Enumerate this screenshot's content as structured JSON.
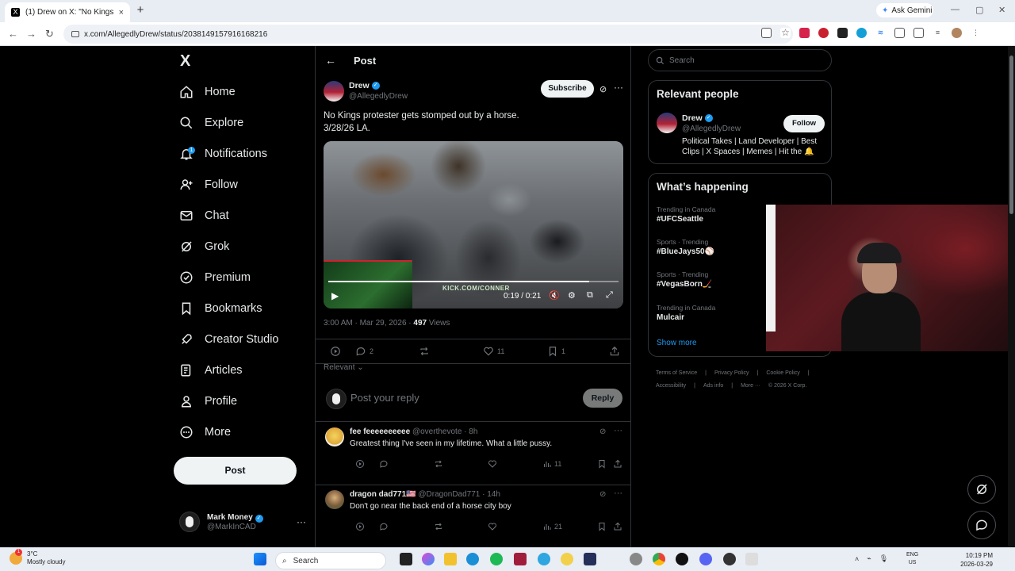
{
  "browser": {
    "tab_title": "(1) Drew on X: \"No Kings prote",
    "tab_favicon": "X",
    "tab_close": "×",
    "new_tab": "+",
    "ask_gemini": "Ask Gemini",
    "url": "x.com/AllegedlyDrew/status/2038149157916168216"
  },
  "sidebar": {
    "logo": "X",
    "items": [
      {
        "label": "Home",
        "icon": "home-icon"
      },
      {
        "label": "Explore",
        "icon": "search-icon"
      },
      {
        "label": "Notifications",
        "icon": "bell-icon",
        "badge": "1"
      },
      {
        "label": "Follow",
        "icon": "add-person-icon"
      },
      {
        "label": "Chat",
        "icon": "mail-icon"
      },
      {
        "label": "Grok",
        "icon": "grok-icon"
      },
      {
        "label": "Premium",
        "icon": "verified-icon"
      },
      {
        "label": "Bookmarks",
        "icon": "bookmark-icon"
      },
      {
        "label": "Creator Studio",
        "icon": "rocket-icon"
      },
      {
        "label": "Articles",
        "icon": "articles-icon"
      },
      {
        "label": "Profile",
        "icon": "person-icon"
      },
      {
        "label": "More",
        "icon": "more-circle-icon"
      }
    ],
    "post_button": "Post",
    "account": {
      "name": "Mark Money",
      "handle": "@MarkInCAD",
      "more": "···"
    }
  },
  "post": {
    "header_title": "Post",
    "author_name": "Drew",
    "author_handle": "@AllegedlyDrew",
    "subscribe": "Subscribe",
    "more": "···",
    "text_line1": "No Kings protester gets stomped out by a horse.",
    "text_line2": "3/28/26 LA.",
    "video": {
      "time": "0:19 / 0:21",
      "watermark": "KICK.COM/CONNER",
      "progress": 0.9
    }
  },
  "meta": {
    "time": "3:00 AM · Mar 29, 2026 · ",
    "views_count": "497",
    "views_label": " Views"
  },
  "actions": {
    "replies": "2",
    "reposts": "",
    "likes": "11",
    "bookmarks": "1"
  },
  "sort_label": "Relevant",
  "reply_box": {
    "placeholder": "Post your reply",
    "button": "Reply"
  },
  "replies": [
    {
      "name": "fee feeeeeeeeee",
      "handle": "@overthevote · 8h",
      "text": "Greatest thing I've seen in my lifetime. What a little pussy.",
      "views": "11"
    },
    {
      "name": "dragon dad771🇺🇸",
      "handle": "@DragonDad771 · 14h",
      "text": "Don't go near the back end of a horse city boy",
      "views": "21"
    }
  ],
  "right": {
    "search_placeholder": "Search",
    "relevant_title": "Relevant people",
    "person": {
      "name": "Drew",
      "handle": "@AllegedlyDrew",
      "bio": "Political Takes | Land Developer | Best Clips | X Spaces | Memes | Hit the 🔔",
      "follow": "Follow"
    },
    "happening_title": "What’s happening",
    "trends": [
      {
        "category": "Trending in Canada",
        "tag": "#UFCSeattle"
      },
      {
        "category": "Sports · Trending",
        "tag": "#BlueJays50⚾"
      },
      {
        "category": "Sports · Trending",
        "tag": "#VegasBorn🏒"
      },
      {
        "category": "Trending in Canada",
        "tag": "Mulcair"
      }
    ],
    "show_more": "Show more",
    "footer": [
      "Terms of Service",
      "|",
      "Privacy Policy",
      "|",
      "Cookie Policy",
      "|",
      "Accessibility",
      "|",
      "Ads info",
      "|",
      "More ···",
      "© 2026 X Corp."
    ]
  },
  "taskbar": {
    "temp": "3°C",
    "weather": "Mostly cloudy",
    "weather_badge": "1",
    "search": "Search",
    "lang1": "ENG",
    "lang2": "US",
    "time": "10:19 PM",
    "date": "2026-03-29"
  },
  "colors": {
    "accent": "#1d9bf0",
    "background": "#000000",
    "border": "#2f3336",
    "muted": "#71767b"
  }
}
